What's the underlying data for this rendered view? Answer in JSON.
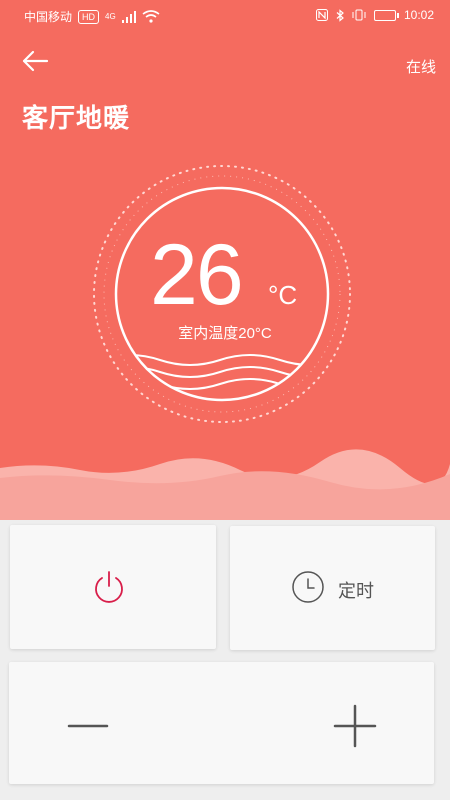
{
  "status_bar": {
    "carrier": "中国移动",
    "hd": "HD",
    "network": "4G",
    "time": "10:02"
  },
  "header": {
    "online_status": "在线",
    "title": "客厅地暖"
  },
  "thermostat": {
    "set_temperature": "26",
    "unit": "°C",
    "room_temperature_label": "室内温度20°C"
  },
  "controls": {
    "timer_label": "定时"
  },
  "colors": {
    "primary": "#f56b5f",
    "power_icon": "#d81e4a",
    "panel_bg": "#f8f8f8",
    "page_bg": "#eeeeee",
    "icon_gray": "#555555"
  }
}
